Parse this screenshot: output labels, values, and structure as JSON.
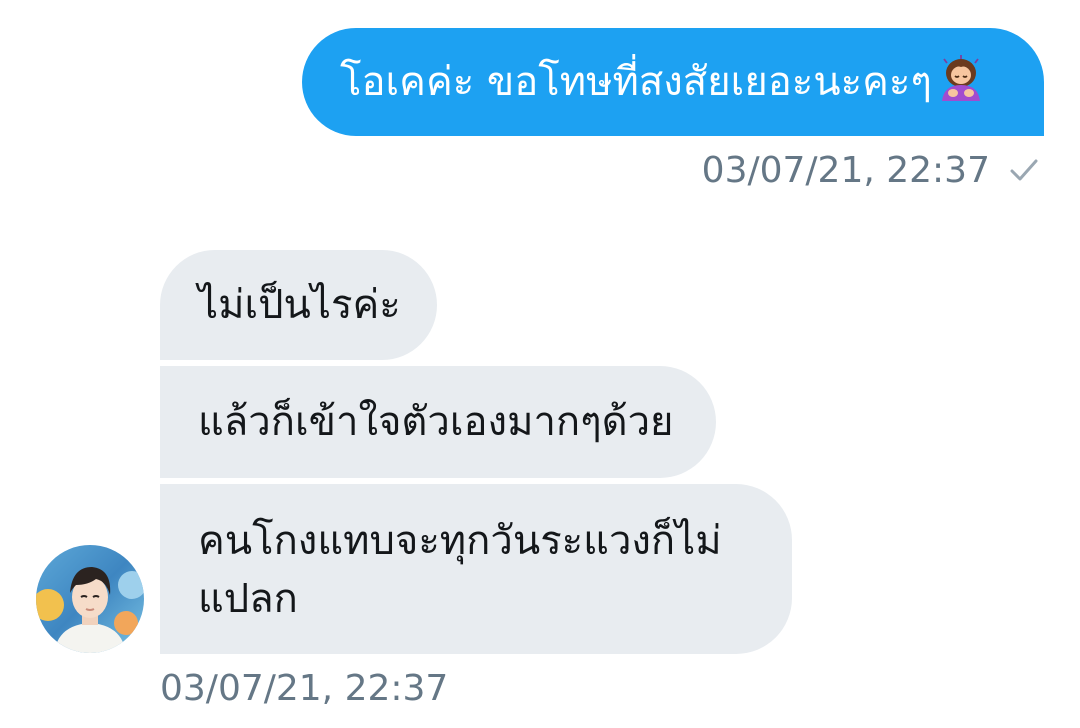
{
  "conversation": {
    "messages": [
      {
        "direction": "outgoing",
        "text": "โอเคค่ะ ขอโทษที่สงสัยเยอะนะคะๆ",
        "emoji": "person-bowing-emoji"
      },
      {
        "direction": "incoming",
        "text": "ไม่เป็นไรค่ะ"
      },
      {
        "direction": "incoming",
        "text": "แล้วก็เข้าใจตัวเองมากๆด้วย"
      },
      {
        "direction": "incoming",
        "lines": [
          "คนโกงแทบจะทุกวันระแวงก็ไม่",
          "แปลก"
        ]
      }
    ],
    "outgoing_timestamp": "03/07/21, 22:37",
    "incoming_timestamp": "03/07/21, 22:37",
    "read_receipt_icon": "checkmark-icon",
    "avatar_icon": "user-avatar"
  },
  "colors": {
    "outgoing_bubble": "#1da1f2",
    "incoming_bubble": "#e8ecf0",
    "timestamp": "#657786",
    "incoming_text": "#14171a"
  }
}
